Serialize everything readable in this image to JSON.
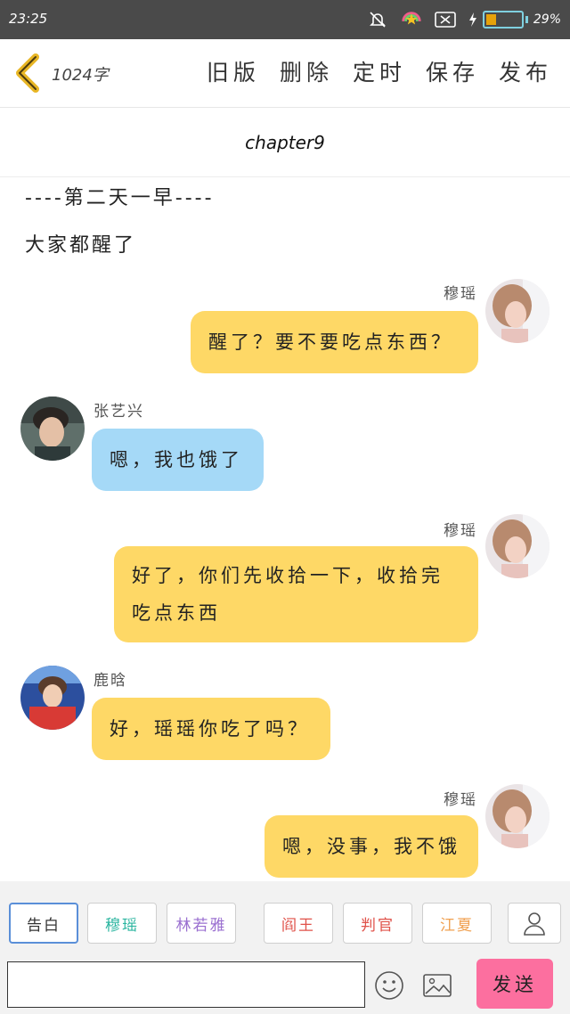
{
  "status_bar": {
    "time": "23:25",
    "battery_percent": "29%",
    "battery_level": 0.29
  },
  "header": {
    "word_count": "1024字",
    "actions": [
      "旧版",
      "删除",
      "定时",
      "保存",
      "发布"
    ]
  },
  "chapter_title": "chapter9",
  "narration": [
    "----第二天一早----",
    "大家都醒了"
  ],
  "messages": [
    {
      "side": "right",
      "name": "穆瑶",
      "text": "醒了？要不要吃点东西？",
      "color": "yellow"
    },
    {
      "side": "left",
      "name": "张艺兴",
      "text": "嗯，我也饿了",
      "color": "blue"
    },
    {
      "side": "right",
      "name": "穆瑶",
      "text_lines": [
        "好了，你们先收拾一下，收拾完",
        "吃点东西"
      ],
      "color": "yellow"
    },
    {
      "side": "left",
      "name": "鹿晗",
      "text": "好，瑶瑶你吃了吗？",
      "color": "yellow"
    },
    {
      "side": "right",
      "name": "穆瑶",
      "text": "嗯，没事，我不饿",
      "color": "yellow"
    }
  ],
  "character_chips": [
    {
      "label": "告白",
      "color": "#333333"
    },
    {
      "label": "穆瑶",
      "color": "#2bb5a0"
    },
    {
      "label": "林若雅",
      "color": "#9a6fd0"
    },
    {
      "label": "阎王",
      "color": "#e0524a"
    },
    {
      "label": "判官",
      "color": "#e0524a"
    },
    {
      "label": "江夏",
      "color": "#f0a050"
    }
  ],
  "input": {
    "value": "",
    "placeholder": ""
  },
  "send_label": "发送",
  "colors": {
    "bubble_yellow": "#fed866",
    "bubble_blue": "#a5d9f7",
    "send": "#fc6f9f",
    "status_bar": "#4a4a4a"
  }
}
